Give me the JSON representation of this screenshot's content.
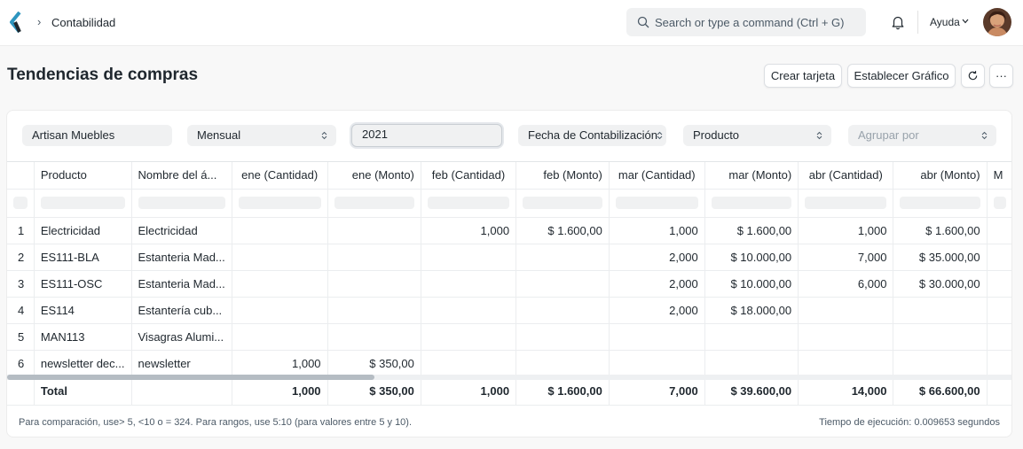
{
  "navbar": {
    "breadcrumb": "Contabilidad",
    "breadcrumb_sep": "›",
    "search_placeholder": "Search or type a command (Ctrl + G)",
    "help_label": "Ayuda"
  },
  "page": {
    "title": "Tendencias de compras",
    "buttons": {
      "create_card": "Crear tarjeta",
      "set_chart": "Establecer Gráfico",
      "more": "···"
    }
  },
  "filters": {
    "company": "Artisan Muebles",
    "period": "Mensual",
    "fiscal_year": "2021",
    "based_on": "Fecha de Contabilización",
    "type": "Producto",
    "group_by_placeholder": "Agrupar por"
  },
  "table": {
    "columns": [
      "",
      "Producto",
      "Nombre del á...",
      "ene (Cantidad)",
      "ene (Monto)",
      "feb (Cantidad)",
      "feb (Monto)",
      "mar (Cantidad)",
      "mar (Monto)",
      "abr (Cantidad)",
      "abr (Monto)",
      "M"
    ],
    "rows": [
      [
        "1",
        "Electricidad",
        "Electricidad",
        "",
        "",
        "1,000",
        "$ 1.600,00",
        "1,000",
        "$ 1.600,00",
        "1,000",
        "$ 1.600,00",
        ""
      ],
      [
        "2",
        "ES111-BLA",
        "Estanteria Mad...",
        "",
        "",
        "",
        "",
        "2,000",
        "$ 10.000,00",
        "7,000",
        "$ 35.000,00",
        ""
      ],
      [
        "3",
        "ES111-OSC",
        "Estanteria Mad...",
        "",
        "",
        "",
        "",
        "2,000",
        "$ 10.000,00",
        "6,000",
        "$ 30.000,00",
        ""
      ],
      [
        "4",
        "ES114",
        "Estantería cub...",
        "",
        "",
        "",
        "",
        "2,000",
        "$ 18.000,00",
        "",
        "",
        ""
      ],
      [
        "5",
        "MAN113",
        "Visagras Alumi...",
        "",
        "",
        "",
        "",
        "",
        "",
        "",
        "",
        ""
      ],
      [
        "6",
        "newsletter dec...",
        "newsletter",
        "1,000",
        "$ 350,00",
        "",
        "",
        "",
        "",
        "",
        "",
        ""
      ]
    ],
    "total": [
      "",
      "Total",
      "",
      "1,000",
      "$ 350,00",
      "1,000",
      "$ 1.600,00",
      "7,000",
      "$ 39.600,00",
      "14,000",
      "$ 66.600,00",
      ""
    ]
  },
  "footer": {
    "hint": "Para comparación, use> 5, <10 o = 324. Para rangos, use 5:10 (para valores entre 5 y 10).",
    "exec_time": "Tiempo de ejecución: 0.009653 segundos"
  },
  "colors": {
    "page_bg": "#f8f8f8",
    "card_bg": "#ffffff",
    "control_bg": "#f0f1f2",
    "text": "#1f272e",
    "muted": "#4c5a67",
    "logo": "#2d95bf"
  }
}
